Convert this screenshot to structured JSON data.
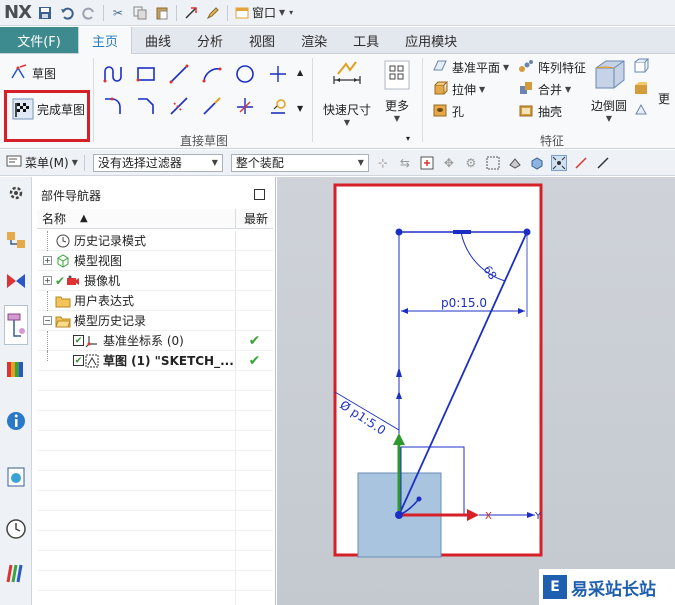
{
  "titlebar": {
    "app_logo": "NX",
    "window_menu": "窗口"
  },
  "tabs": [
    {
      "label": "文件(F)",
      "active": false
    },
    {
      "label": "主页",
      "active": true
    },
    {
      "label": "曲线",
      "active": false
    },
    {
      "label": "分析",
      "active": false
    },
    {
      "label": "视图",
      "active": false
    },
    {
      "label": "渲染",
      "active": false
    },
    {
      "label": "工具",
      "active": false
    },
    {
      "label": "应用模块",
      "active": false
    }
  ],
  "ribbon": {
    "sketch_label": "草图",
    "finish_sketch_label": "完成草图",
    "direct_sketch_group": "直接草图",
    "quick_dimension_label": "快速尺寸",
    "more_label": "更多",
    "datum_plane_label": "基准平面",
    "pattern_feature_label": "阵列特征",
    "extrude_label": "拉伸",
    "unite_label": "合并",
    "hole_label": "孔",
    "shell_label": "抽壳",
    "edge_blend_label": "边倒圆",
    "feature_group": "特征",
    "more_right_label": "更"
  },
  "toolbar2": {
    "menu_label": "菜单(M)",
    "filter_value": "没有选择过滤器",
    "assembly_value": "整个装配"
  },
  "navigator": {
    "title": "部件导航器",
    "col_name": "名称",
    "col_latest": "最新",
    "rows": [
      {
        "label": "历史记录模式",
        "indent": 1,
        "expander": "",
        "checked": false,
        "latest": ""
      },
      {
        "label": "模型视图",
        "indent": 0,
        "expander": "+",
        "checked": false,
        "latest": ""
      },
      {
        "label": "摄像机",
        "indent": 0,
        "expander": "+",
        "checked": true,
        "latest": ""
      },
      {
        "label": "用户表达式",
        "indent": 1,
        "expander": "",
        "checked": false,
        "latest": ""
      },
      {
        "label": "模型历史记录",
        "indent": 0,
        "expander": "−",
        "checked": false,
        "latest": ""
      },
      {
        "label": "基准坐标系 (0)",
        "indent": 2,
        "expander": "",
        "checked": true,
        "latest": "✔"
      },
      {
        "label": "草图 (1) \"SKETCH_...",
        "indent": 2,
        "expander": "",
        "checked": true,
        "latest": "✔"
      }
    ]
  },
  "graphics": {
    "dim_horizontal": "p0:15.0",
    "dim_diameter": "Ø p1:5.0",
    "dim_angle": "68",
    "axis_x": "X",
    "axis_y": "Y"
  },
  "watermark": {
    "logo": "E",
    "text": "易采站长站"
  },
  "colors": {
    "accent": "#2a7bc0",
    "file_tab": "#3d8b8f",
    "highlight_red": "#d62028",
    "sketch_blue": "#1c2fc4"
  }
}
